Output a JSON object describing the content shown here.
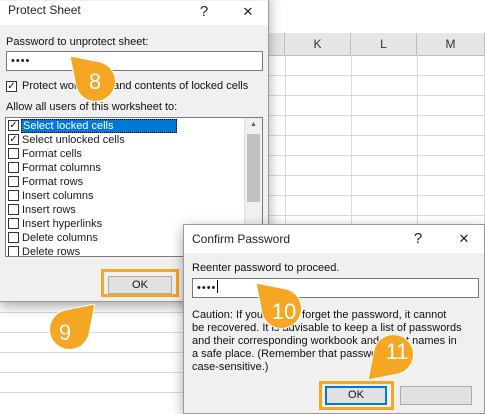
{
  "spreadsheet": {
    "columns": [
      "K",
      "L",
      "M"
    ]
  },
  "protect_dialog": {
    "title": "Protect Sheet",
    "help_glyph": "?",
    "close_glyph": "✕",
    "password_label": "Password to unprotect sheet:",
    "password_value": "••••",
    "protect_checkbox_label": "Protect worksheet and contents of locked cells",
    "protect_checked": true,
    "allow_label": "Allow all users of this worksheet to:",
    "permissions": [
      {
        "label": "Select locked cells",
        "checked": true,
        "selected": true
      },
      {
        "label": "Select unlocked cells",
        "checked": true,
        "selected": false
      },
      {
        "label": "Format cells",
        "checked": false,
        "selected": false
      },
      {
        "label": "Format columns",
        "checked": false,
        "selected": false
      },
      {
        "label": "Format rows",
        "checked": false,
        "selected": false
      },
      {
        "label": "Insert columns",
        "checked": false,
        "selected": false
      },
      {
        "label": "Insert rows",
        "checked": false,
        "selected": false
      },
      {
        "label": "Insert hyperlinks",
        "checked": false,
        "selected": false
      },
      {
        "label": "Delete columns",
        "checked": false,
        "selected": false
      },
      {
        "label": "Delete rows",
        "checked": false,
        "selected": false
      }
    ],
    "ok_label": "OK"
  },
  "confirm_dialog": {
    "title": "Confirm Password",
    "help_glyph": "?",
    "close_glyph": "✕",
    "reenter_label": "Reenter password to proceed.",
    "password_value": "••••",
    "caution_lines": [
      "Caution: If you lose or forget the password, it cannot",
      "be recovered. It is advisable to keep a list of passwords",
      "and their corresponding workbook and sheet names in",
      "a safe place.  (Remember that passwords are",
      "case-sensitive.)"
    ],
    "ok_label": "OK"
  },
  "steps": [
    "8",
    "9",
    "10",
    "11"
  ],
  "colors": {
    "accent": "#0078d7",
    "highlight": "#f5a623",
    "badge": "#f5a623"
  }
}
